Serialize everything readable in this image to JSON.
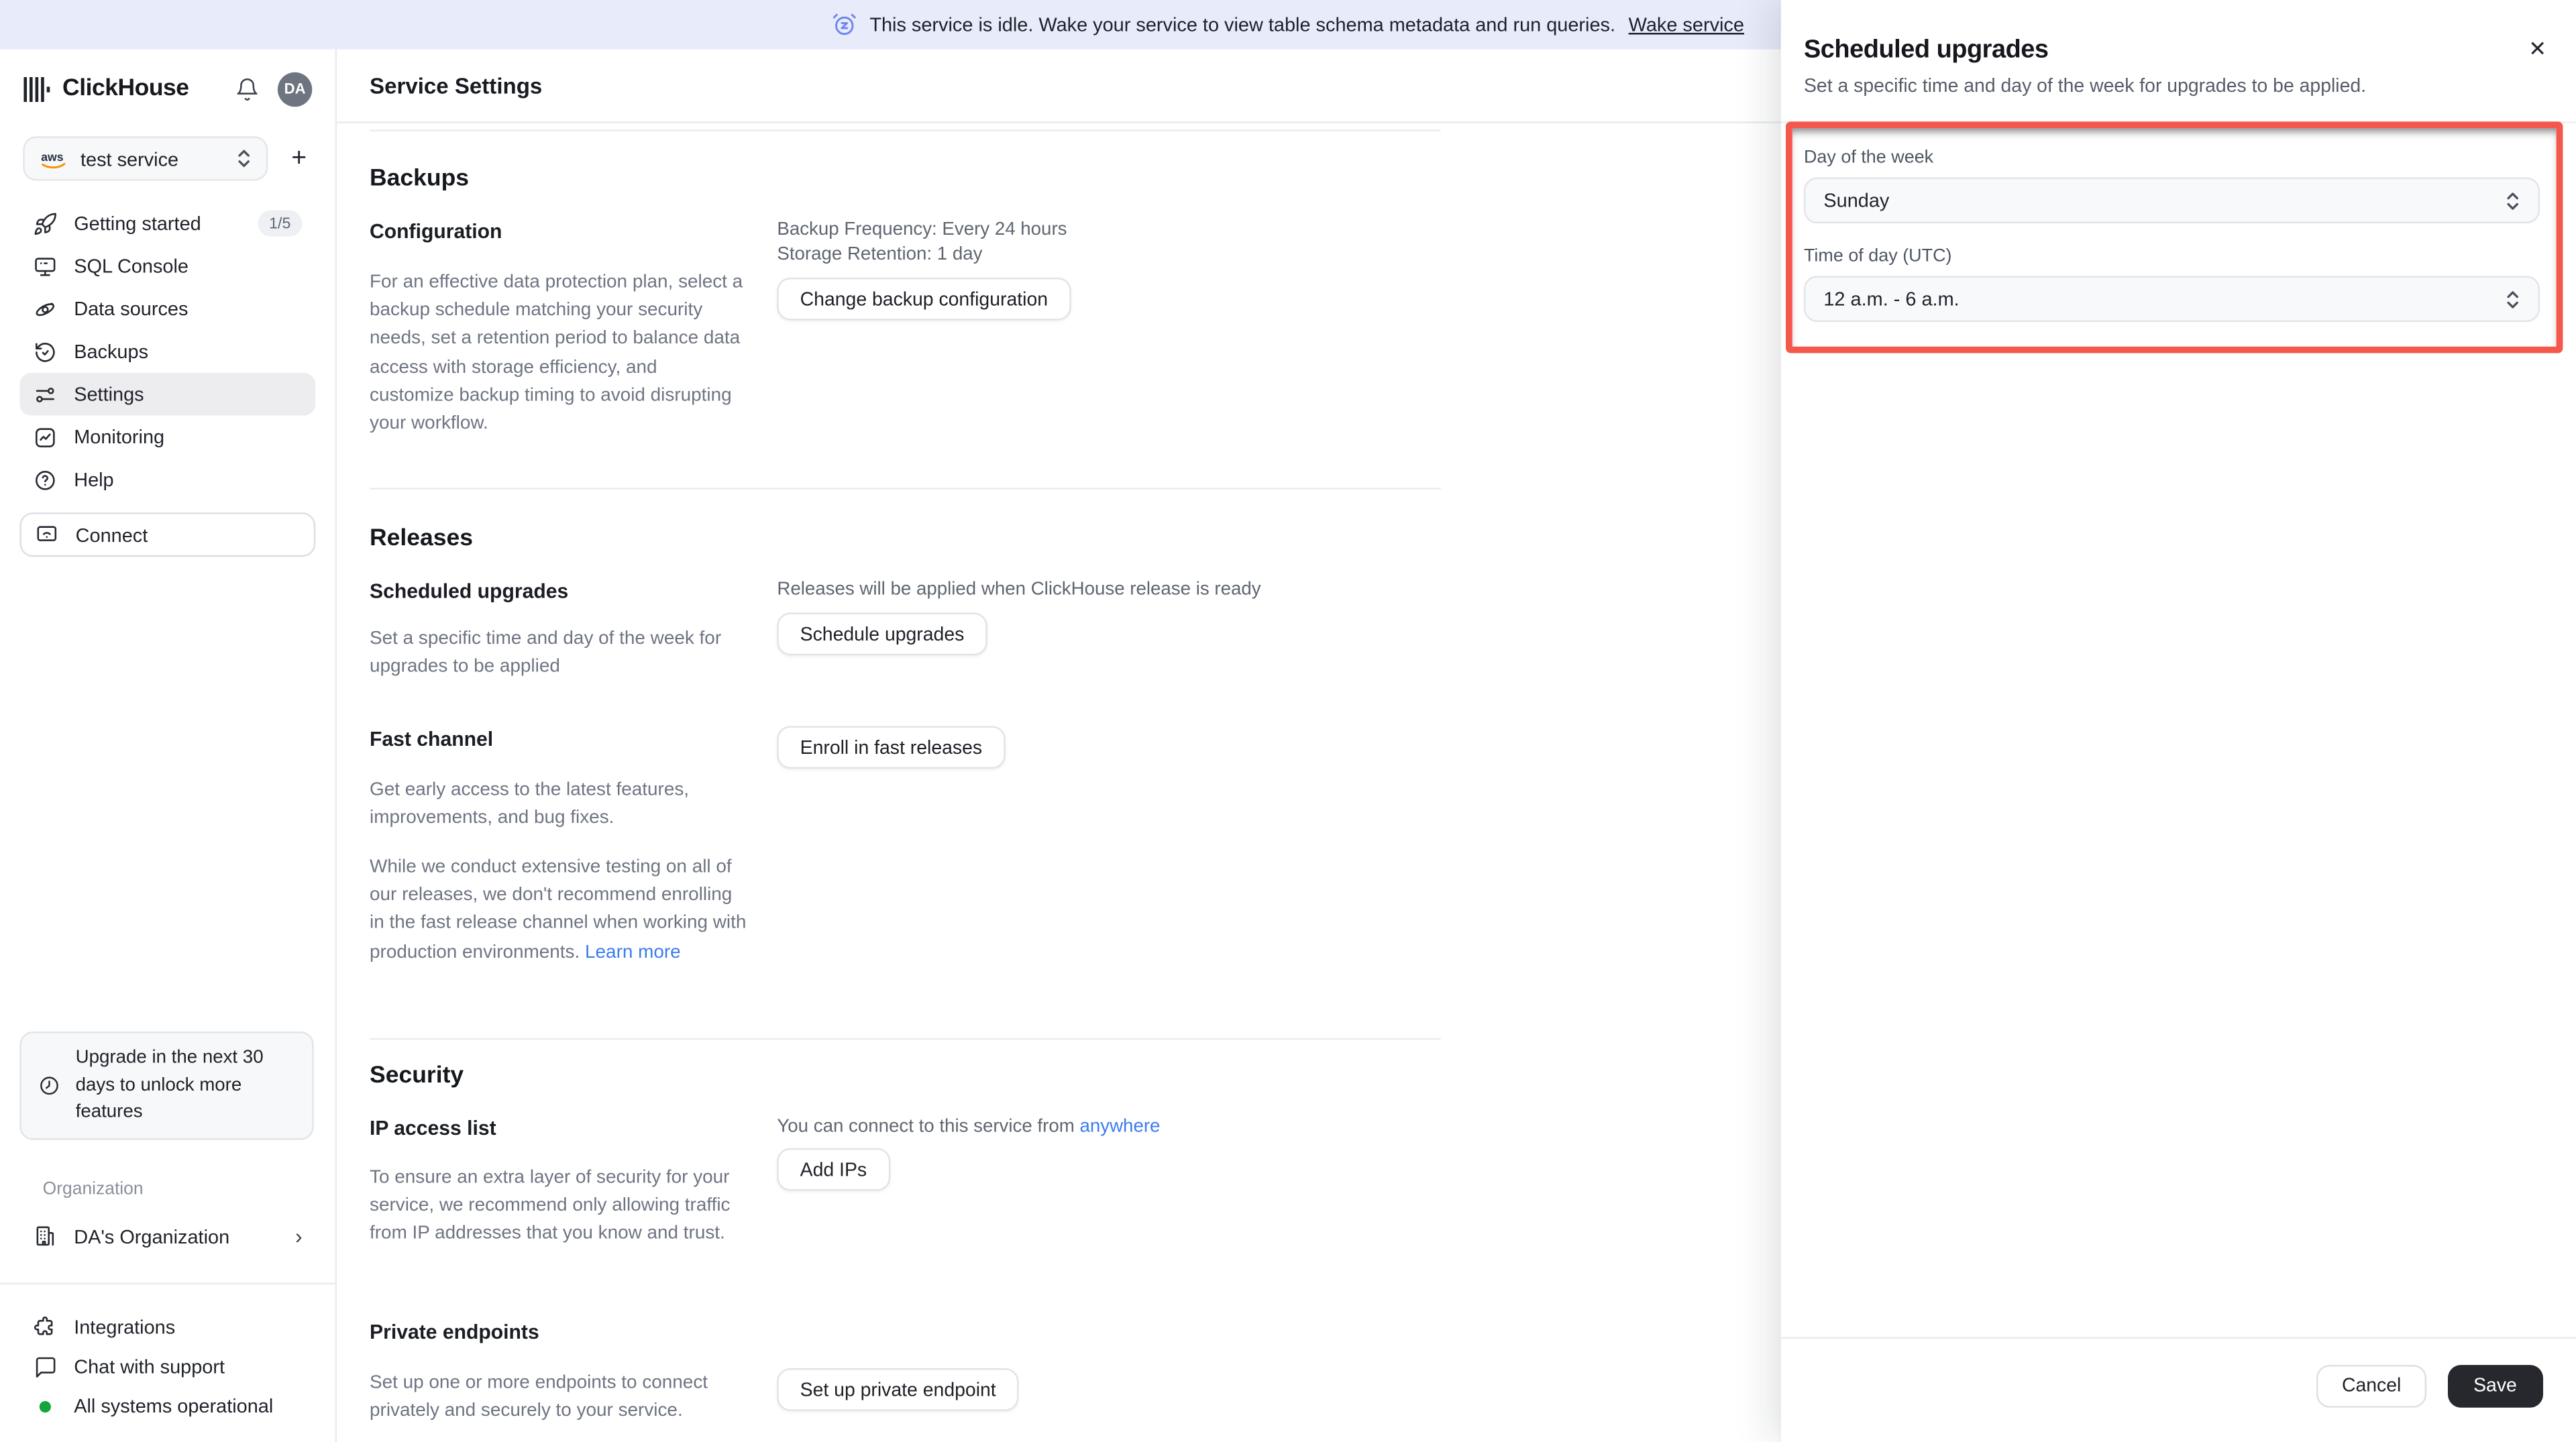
{
  "banner": {
    "icon": "alarm-snooze-icon",
    "text": "This service is idle. Wake your service to view table schema metadata and run queries.",
    "link_label": "Wake service",
    "background_color": "#e7ebfa"
  },
  "sidebar": {
    "brand": "ClickHouse",
    "avatar_initials": "DA",
    "service_selector": {
      "provider": "aws",
      "value": "test service"
    },
    "nav": [
      {
        "label": "Getting started",
        "badge": "1/5"
      },
      {
        "label": "SQL Console"
      },
      {
        "label": "Data sources"
      },
      {
        "label": "Backups"
      },
      {
        "label": "Settings",
        "active": true
      },
      {
        "label": "Monitoring"
      },
      {
        "label": "Help"
      }
    ],
    "connect_label": "Connect",
    "upgrade_notice": "Upgrade in the next 30 days to unlock more features",
    "organization_label": "Organization",
    "organization_name": "DA's Organization",
    "footer": [
      {
        "label": "Integrations"
      },
      {
        "label": "Chat with support"
      },
      {
        "label": "All systems operational",
        "status_color": "#16a43c"
      }
    ]
  },
  "main": {
    "title": "Service Settings",
    "backups": {
      "heading": "Backups",
      "config_label": "Configuration",
      "config_desc": "For an effective data protection plan, select a backup schedule matching your security needs, set a retention period to balance data access with storage efficiency, and customize backup timing to avoid disrupting your workflow.",
      "meta_line1": "Backup Frequency: Every 24 hours",
      "meta_line2": "Storage Retention: 1 day",
      "button_label": "Change backup configuration"
    },
    "releases": {
      "heading": "Releases",
      "scheduled_label": "Scheduled upgrades",
      "scheduled_desc": "Set a specific time and day of the week for upgrades to be applied",
      "scheduled_meta": "Releases will be applied when ClickHouse release is ready",
      "scheduled_button": "Schedule upgrades",
      "fast_label": "Fast channel",
      "fast_desc1": "Get early access to the latest features, improvements, and bug fixes.",
      "fast_desc2": "While we conduct extensive testing on all of our releases, we don't recommend enrolling in the fast release channel when working with production environments.",
      "fast_link": "Learn more",
      "fast_button": "Enroll in fast releases"
    },
    "security": {
      "heading": "Security",
      "ip_label": "IP access list",
      "ip_desc": "To ensure an extra layer of security for your service, we recommend only allowing traffic from IP addresses that you know and trust.",
      "ip_meta_prefix": "You can connect to this service from ",
      "ip_meta_link": "anywhere",
      "ip_button": "Add IPs",
      "private_label": "Private endpoints",
      "private_desc": "Set up one or more endpoints to connect privately and securely to your service.",
      "private_button": "Set up private endpoint"
    }
  },
  "panel": {
    "title": "Scheduled upgrades",
    "subtitle": "Set a specific time and day of the week for upgrades to be applied.",
    "fields": [
      {
        "label": "Day of the week",
        "value": "Sunday"
      },
      {
        "label": "Time of day (UTC)",
        "value": "12 a.m. - 6 a.m."
      }
    ],
    "cancel_label": "Cancel",
    "save_label": "Save",
    "highlight_color": "#f4584c"
  },
  "icons": {
    "close": "✕",
    "chevron_right": "›",
    "plus": "+"
  },
  "colors": {
    "link_blue": "#3b7cf0",
    "status_green": "#16a43c",
    "save_dark": "#26282e",
    "annotation_red": "#f4584c",
    "banner_bg": "#e7ebfa"
  }
}
